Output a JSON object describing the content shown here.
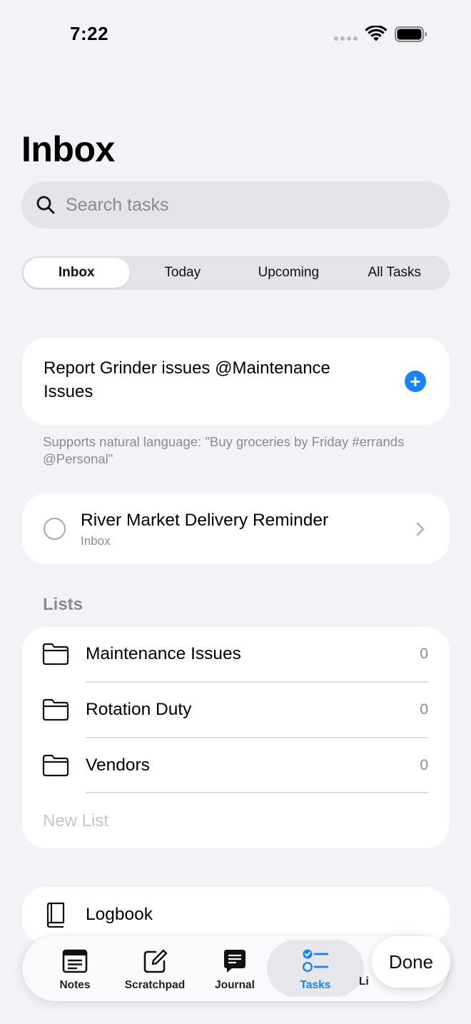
{
  "status_bar": {
    "time": "7:22"
  },
  "page": {
    "title": "Inbox"
  },
  "search": {
    "placeholder": "Search tasks"
  },
  "segments": [
    {
      "label": "Inbox",
      "active": true
    },
    {
      "label": "Today",
      "active": false
    },
    {
      "label": "Upcoming",
      "active": false
    },
    {
      "label": "All Tasks",
      "active": false
    }
  ],
  "quick_add": {
    "text": "Report Grinder issues @Maintenance Issues",
    "hint": "Supports natural language: \"Buy groceries by Friday #errands @Personal\""
  },
  "task": {
    "title": "River Market Delivery Reminder",
    "list": "Inbox"
  },
  "lists": {
    "header": "Lists",
    "items": [
      {
        "name": "Maintenance Issues",
        "count": "0"
      },
      {
        "name": "Rotation Duty",
        "count": "0"
      },
      {
        "name": "Vendors",
        "count": "0"
      }
    ],
    "new_list_placeholder": "New List"
  },
  "logbook": {
    "label": "Logbook"
  },
  "tab_bar": {
    "tabs": [
      {
        "label": "Notes",
        "icon": "notes-icon"
      },
      {
        "label": "Scratchpad",
        "icon": "scratchpad-icon"
      },
      {
        "label": "Journal",
        "icon": "journal-icon"
      },
      {
        "label": "Tasks",
        "icon": "tasks-icon",
        "active": true
      }
    ],
    "partially_hidden_label": "Li"
  },
  "done_button": {
    "label": "Done"
  },
  "colors": {
    "accent": "#1a82f7",
    "background": "#f2f2f7",
    "secondary_text": "#8a8a8f"
  }
}
